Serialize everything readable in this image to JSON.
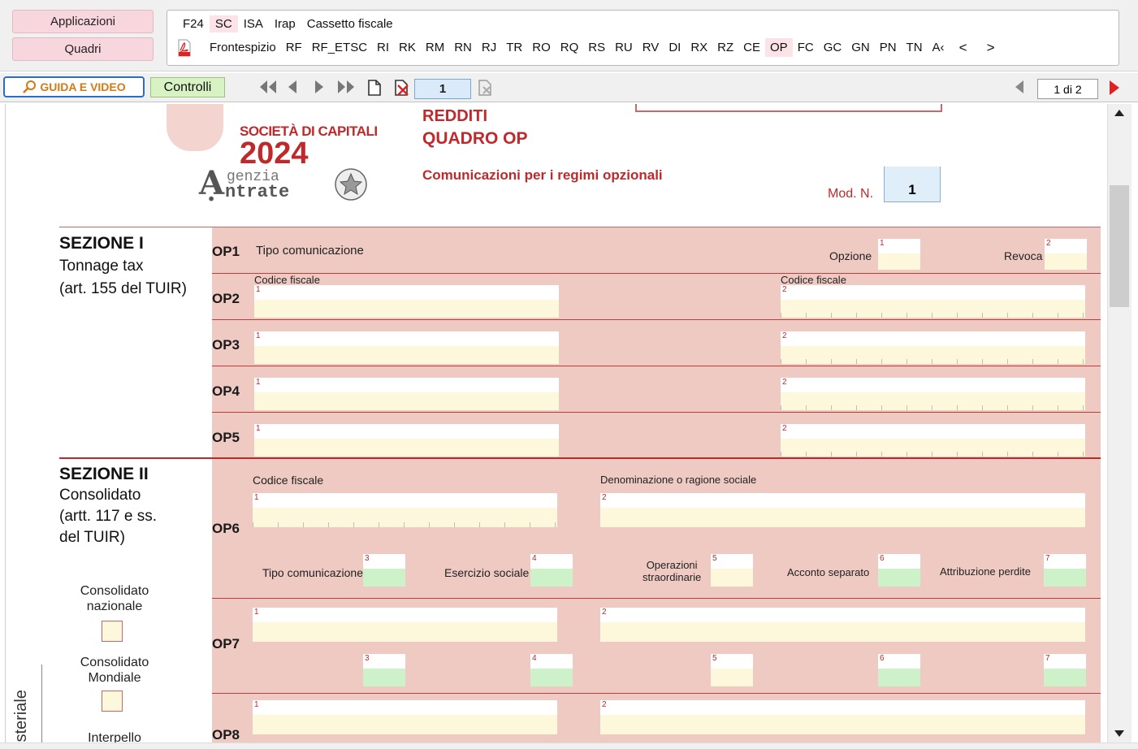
{
  "top": {
    "applicazioni": "Applicazioni",
    "quadri": "Quadri",
    "nav_row1": [
      {
        "label": "F24",
        "selected": false
      },
      {
        "label": "SC",
        "selected": true
      },
      {
        "label": "ISA",
        "selected": false
      },
      {
        "label": "Irap",
        "selected": false
      },
      {
        "label": "Cassetto fiscale",
        "selected": false
      }
    ],
    "nav_row2": [
      {
        "label": "Frontespizio",
        "selected": false
      },
      {
        "label": "RF",
        "selected": false
      },
      {
        "label": "RF_ETSC",
        "selected": false
      },
      {
        "label": "RI",
        "selected": false
      },
      {
        "label": "RK",
        "selected": false
      },
      {
        "label": "RM",
        "selected": false
      },
      {
        "label": "RN",
        "selected": false
      },
      {
        "label": "RJ",
        "selected": false
      },
      {
        "label": "TR",
        "selected": false
      },
      {
        "label": "RO",
        "selected": false
      },
      {
        "label": "RQ",
        "selected": false
      },
      {
        "label": "RS",
        "selected": false
      },
      {
        "label": "RU",
        "selected": false
      },
      {
        "label": "RV",
        "selected": false
      },
      {
        "label": "DI",
        "selected": false
      },
      {
        "label": "RX",
        "selected": false
      },
      {
        "label": "RZ",
        "selected": false
      },
      {
        "label": "CE",
        "selected": false
      },
      {
        "label": "OP",
        "selected": true
      },
      {
        "label": "FC",
        "selected": false
      },
      {
        "label": "GC",
        "selected": false
      },
      {
        "label": "GN",
        "selected": false
      },
      {
        "label": "PN",
        "selected": false
      },
      {
        "label": "TN",
        "selected": false
      },
      {
        "label": "A‹",
        "selected": false
      }
    ],
    "prev_arrow": "<",
    "next_arrow": ">"
  },
  "toolbar": {
    "guida": "GUIDA E VIDEO",
    "controlli": "Controlli",
    "current_page": "1",
    "page_count": "1 di 2"
  },
  "header": {
    "brand_line1": "SOCIETÀ DI CAPITALI",
    "brand_year": "2024",
    "agency_line1": "genzia",
    "agency_line2": "ntrate",
    "redditi": "REDDITI",
    "quadro": "QUADRO OP",
    "subtitle": "Comunicazioni per i regimi opzionali",
    "mod_label": "Mod. N.",
    "mod_value": "1"
  },
  "sezione1": {
    "title": "SEZIONE I",
    "line1": "Tonnage tax",
    "line2": "(art. 155 del TUIR)",
    "op1": {
      "code": "OP1",
      "label": "Tipo comunicazione",
      "opzione": "Opzione",
      "revoca": "Revoca"
    },
    "op2": {
      "code": "OP2",
      "cf1": "Codice fiscale",
      "cf2": "Codice fiscale"
    },
    "op3": {
      "code": "OP3"
    },
    "op4": {
      "code": "OP4"
    },
    "op5": {
      "code": "OP5"
    }
  },
  "sezione2": {
    "title": "SEZIONE II",
    "line1": "Consolidato",
    "line2": "(artt. 117 e ss.",
    "line3": "del TUIR)",
    "naz_1": "Consolidato",
    "naz_2": "nazionale",
    "mond_1": "Consolidato",
    "mond_2": "Mondiale",
    "interpello": "Interpello",
    "side_vertical": "isteriale",
    "op6": {
      "code": "OP6",
      "cf": "Codice fiscale",
      "denominazione": "Denominazione o ragione sociale",
      "tipo": "Tipo comunicazione",
      "esercizio": "Esercizio sociale",
      "operazioni_1": "Operazioni",
      "operazioni_2": "straordinarie",
      "acconto": "Acconto separato",
      "attribuzione": "Attribuzione perdite"
    },
    "op7": {
      "code": "OP7"
    },
    "op8": {
      "code": "OP8"
    }
  },
  "field_numbers": {
    "n1": "1",
    "n2": "2",
    "n3": "3",
    "n4": "4",
    "n5": "5",
    "n6": "6",
    "n7": "7"
  },
  "colors": {
    "panel": "#eecac3",
    "field": "#fdf8dc",
    "green_field": "#cdf1c9",
    "accent_red": "#c0292b"
  }
}
